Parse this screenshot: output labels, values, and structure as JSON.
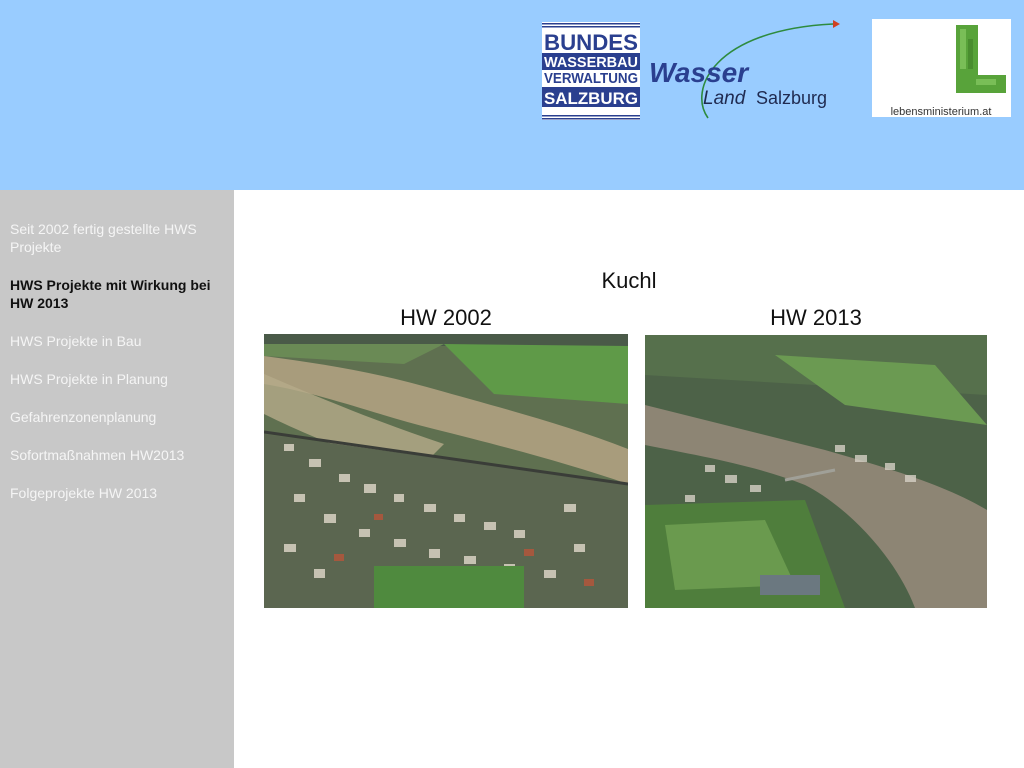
{
  "header": {
    "logo_bundes": {
      "line1": "BUNDES",
      "line2": "WASSERBAU",
      "line3": "VERWALTUNG",
      "line4": "SALZBURG"
    },
    "logo_wasser": {
      "word": "Wasser",
      "line2_a": "Land",
      "line2_b": "Salzburg"
    },
    "logo_lebens": {
      "text": "lebensministerium.at"
    }
  },
  "sidebar": {
    "items": [
      {
        "label": "Seit 2002 fertig gestellte HWS Projekte",
        "active": false
      },
      {
        "label": "HWS Projekte mit Wirkung bei HW 2013",
        "active": true
      },
      {
        "label": "HWS Projekte in Bau",
        "active": false
      },
      {
        "label": "HWS Projekte in Planung",
        "active": false
      },
      {
        "label": "Gefahrenzonenplanung",
        "active": false
      },
      {
        "label": "Sofortmaßnahmen HW2013",
        "active": false
      },
      {
        "label": "Folgeprojekte HW 2013",
        "active": false
      }
    ]
  },
  "main": {
    "title": "Kuchl",
    "photos": [
      {
        "caption": "HW 2002"
      },
      {
        "caption": "HW 2013"
      }
    ]
  },
  "colors": {
    "header_bg": "#99ccff",
    "sidebar_bg": "#c8c8c8",
    "logo_blue": "#2a3f8f",
    "logo_green": "#2e8b3e"
  }
}
